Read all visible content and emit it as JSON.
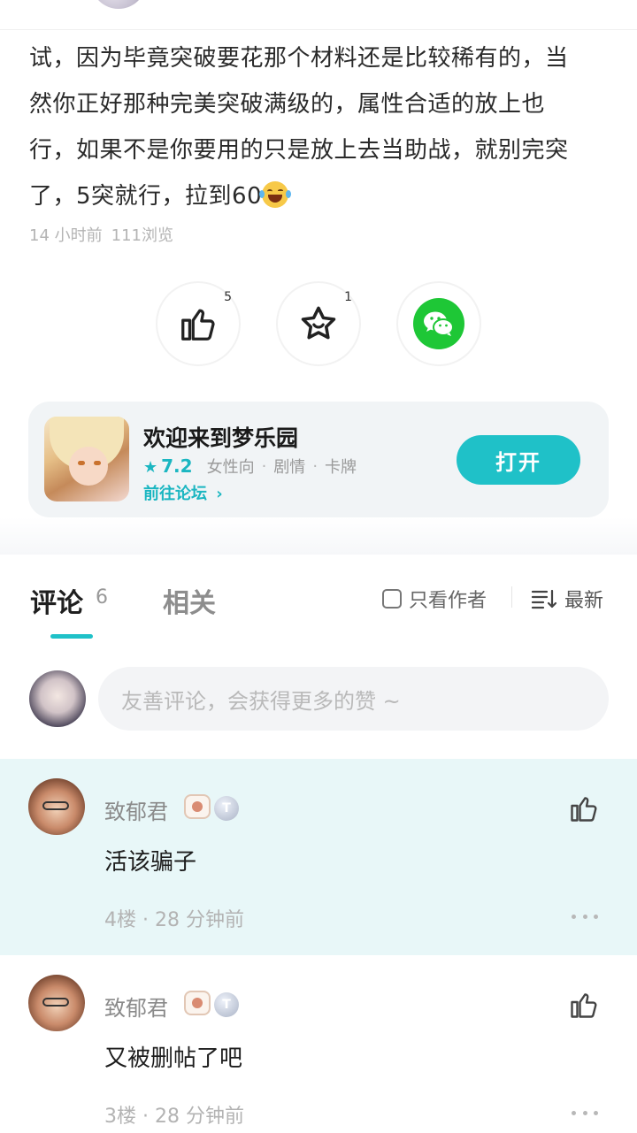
{
  "article": {
    "lines": [
      "试，因为毕竟突破要花那个材料还是比较稀有的，当",
      "然你正好那种完美突破满级的，属性合适的放上也",
      "行，如果不是你要用的只是放上去当助战，就别完突",
      "了，5突就行，拉到60"
    ],
    "emoji": "laughing-with-tears-emoji",
    "time": "14 小时前",
    "views": "111浏览"
  },
  "actions": {
    "like_count": "5",
    "favorite_count": "1",
    "icons": [
      "thumbs-up-icon",
      "star-icon",
      "wechat-icon"
    ],
    "wechat_color": "#1ec736"
  },
  "game_card": {
    "title": "欢迎来到梦乐园",
    "rating": "7.2",
    "tags": [
      "女性向",
      "剧情",
      "卡牌"
    ],
    "forum_link": "前往论坛",
    "open_button": "打开",
    "accent": "#1fc1c8"
  },
  "comments_header": {
    "tab_comments": "评论",
    "comment_count": "6",
    "tab_related": "相关",
    "author_only": "只看作者",
    "sort": "最新"
  },
  "comment_input": {
    "placeholder": "友善评论，会获得更多的赞 ~"
  },
  "comments": [
    {
      "author": "致郁君",
      "badge": "T",
      "text": "活该骗子",
      "floor": "4楼",
      "time": "28 分钟前",
      "highlighted": true
    },
    {
      "author": "致郁君",
      "badge": "T",
      "text": "又被删帖了吧",
      "floor": "3楼",
      "time": "28 分钟前",
      "highlighted": false
    }
  ]
}
